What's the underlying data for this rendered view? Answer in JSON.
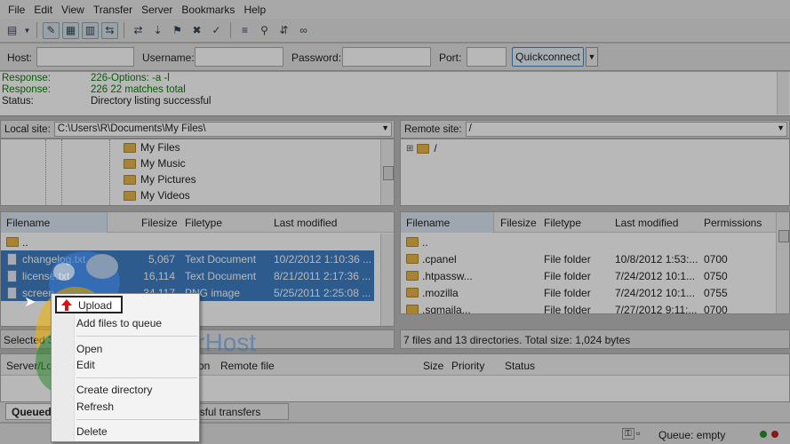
{
  "menu": [
    "File",
    "Edit",
    "View",
    "Transfer",
    "Server",
    "Bookmarks",
    "Help"
  ],
  "quickconnect": {
    "host_label": "Host:",
    "username_label": "Username:",
    "password_label": "Password:",
    "port_label": "Port:",
    "button": "Quickconnect",
    "host_value": "",
    "username_value": "",
    "password_value": "",
    "port_value": ""
  },
  "log": [
    {
      "key": "Response:",
      "value": "226-Options: -a -l",
      "type": "green"
    },
    {
      "key": "Response:",
      "value": "226 22 matches total",
      "type": "green"
    },
    {
      "key": "Status:",
      "value": "Directory listing successful",
      "type": "normal"
    }
  ],
  "local": {
    "site_label": "Local site:",
    "path": "C:\\Users\\R\\Documents\\My Files\\",
    "tree": [
      "My Files",
      "My Music",
      "My Pictures",
      "My Videos"
    ],
    "columns": [
      "Filename",
      "Filesize",
      "Filetype",
      "Last modified"
    ],
    "rows": [
      {
        "name": "..",
        "size": "",
        "type": "",
        "modified": ""
      },
      {
        "name": "changelog.txt",
        "size": "5,067",
        "type": "Text Document",
        "modified": "10/2/2012 1:10:36 ..."
      },
      {
        "name": "license.txt",
        "size": "16,114",
        "type": "Text Document",
        "modified": "8/21/2011 2:17:36 ..."
      },
      {
        "name": "screen...",
        "size": "34,117",
        "type": "PNG image",
        "modified": "5/25/2011 2:25:08 ..."
      }
    ],
    "status": "Selected 3"
  },
  "remote": {
    "site_label": "Remote site:",
    "path": "/",
    "tree": [
      "/"
    ],
    "columns": [
      "Filename",
      "Filesize",
      "Filetype",
      "Last modified",
      "Permissions"
    ],
    "rows": [
      {
        "name": "..",
        "size": "",
        "type": "",
        "modified": "",
        "perm": ""
      },
      {
        "name": ".cpanel",
        "size": "",
        "type": "File folder",
        "modified": "10/8/2012 1:53:...",
        "perm": "0700"
      },
      {
        "name": ".htpassw...",
        "size": "",
        "type": "File folder",
        "modified": "7/24/2012 10:1...",
        "perm": "0750"
      },
      {
        "name": ".mozilla",
        "size": "",
        "type": "File folder",
        "modified": "7/24/2012 10:1...",
        "perm": "0755"
      },
      {
        "name": ".sqmaila...",
        "size": "",
        "type": "File folder",
        "modified": "7/27/2012 9:11:...",
        "perm": "0700"
      }
    ],
    "status": "7 files and 13 directories. Total size: 1,024 bytes"
  },
  "queue": {
    "columns": [
      "Server/Lo",
      "on",
      "Remote file",
      "Size",
      "Priority",
      "Status"
    ],
    "tabs": [
      "Queued",
      "essful transfers"
    ],
    "status": "Queue: empty"
  },
  "context_menu": {
    "upload": "Upload",
    "add_to_queue": "Add files to queue",
    "open": "Open",
    "edit": "Edit",
    "create_directory": "Create directory",
    "refresh": "Refresh",
    "delete": "Delete"
  },
  "watermark": "FlipperHost"
}
